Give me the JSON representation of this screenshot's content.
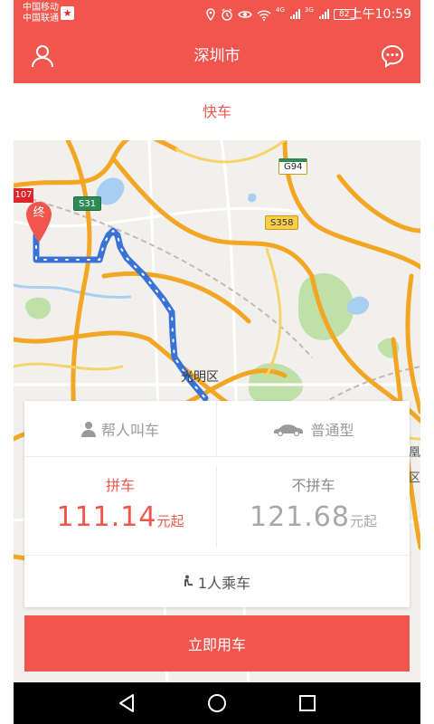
{
  "status_bar": {
    "carrier_1": "中国移动",
    "carrier_2": "中国联通",
    "network_1": "4G",
    "network_2": "3G",
    "battery": "82",
    "time": "上午10:59"
  },
  "header": {
    "title": "深圳市",
    "user_icon": "user-icon",
    "message_icon": "message-icon"
  },
  "tabs": {
    "active": "快车"
  },
  "map": {
    "district": "光明区",
    "end_marker": "终",
    "road_labels": [
      "S31",
      "G94",
      "S358",
      "107"
    ],
    "edge_labels": [
      "凤凰",
      "区"
    ],
    "route_color": "#3a73d6"
  },
  "booking": {
    "for_others": "帮人叫车",
    "car_type": "普通型",
    "carpool": {
      "title": "拼车",
      "price": "111.14",
      "unit": "元起"
    },
    "no_carpool": {
      "title": "不拼车",
      "price": "121.68",
      "unit": "元起"
    },
    "passengers": "1人乘车",
    "confirm": "立即用车"
  },
  "colors": {
    "accent": "#f0564e",
    "muted": "#a8a8a8"
  }
}
